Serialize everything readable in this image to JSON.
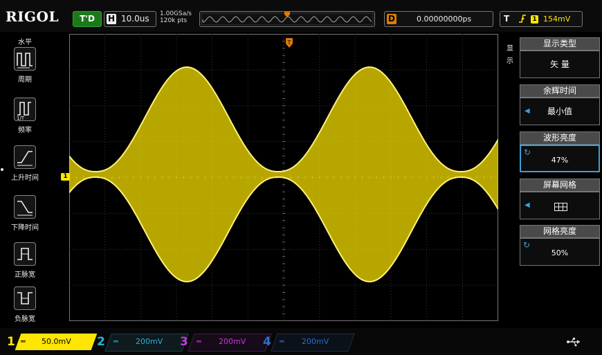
{
  "brand": "RIGOL",
  "trigger_status": "T'D",
  "horizontal": {
    "label": "H",
    "timebase": "10.0us"
  },
  "acquisition": {
    "sample_rate": "1.00GSa/s",
    "memory_depth": "120k pts"
  },
  "delay": {
    "label": "D",
    "value": "0.00000000ps"
  },
  "trigger": {
    "label": "T",
    "edge_icon": "rising-edge-icon",
    "source": "1",
    "level": "154mV"
  },
  "left_menu": {
    "title": "水平",
    "items": [
      {
        "label": "周期",
        "icon": "period-icon"
      },
      {
        "label": "频率",
        "icon": "frequency-icon"
      },
      {
        "label": "上升时间",
        "icon": "rise-time-icon"
      },
      {
        "label": "下降时间",
        "icon": "fall-time-icon"
      },
      {
        "label": "正脉宽",
        "icon": "positive-width-icon"
      },
      {
        "label": "负脉宽",
        "icon": "negative-width-icon"
      }
    ]
  },
  "right_menu": {
    "side_title": "显示",
    "items": [
      {
        "title": "显示类型",
        "value": "矢 量"
      },
      {
        "title": "余辉时间",
        "value": "最小值"
      },
      {
        "title": "波形亮度",
        "value": "47%"
      },
      {
        "title": "屏幕网格",
        "value": ""
      },
      {
        "title": "网格亮度",
        "value": "50%"
      }
    ]
  },
  "channel_marker": "1",
  "channels": [
    {
      "number": "1",
      "scale": "50.0mV",
      "color": "#ffe600",
      "active": true
    },
    {
      "number": "2",
      "scale": "200mV",
      "color": "#25b6d8",
      "active": false
    },
    {
      "number": "3",
      "scale": "200mV",
      "color": "#c43bd6",
      "active": false
    },
    {
      "number": "4",
      "scale": "200mV",
      "color": "#2a6fd6",
      "active": false
    }
  ],
  "colors": {
    "trace": "#ffe600",
    "accent": "#3aa0d8",
    "trigger_marker": "#e07b00"
  }
}
